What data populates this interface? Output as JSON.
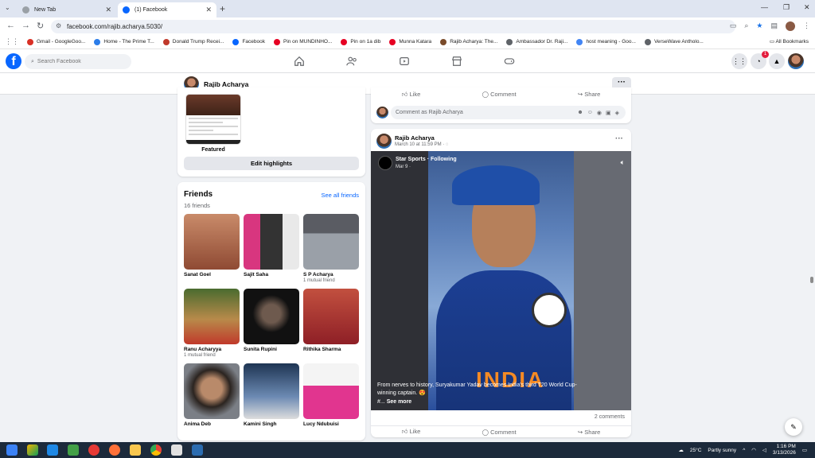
{
  "browser": {
    "tabs": [
      {
        "label": "New Tab",
        "active": false
      },
      {
        "label": "(1) Facebook",
        "active": true
      }
    ],
    "url": "facebook.com/rajib.acharya.5030/",
    "bookmarks": [
      {
        "label": "Gmail - GoogleGoo...",
        "color": "#d93025"
      },
      {
        "label": "Home - The Prime T...",
        "color": "#2b7de9"
      },
      {
        "label": "Donald Trump Recei...",
        "color": "#c0392b"
      },
      {
        "label": "Facebook",
        "color": "#0866ff"
      },
      {
        "label": "Pin on MUNDINHO...",
        "color": "#e60023"
      },
      {
        "label": "Pin on 1a dib",
        "color": "#e60023"
      },
      {
        "label": "Munna Katara",
        "color": "#e60023"
      },
      {
        "label": "Rajib Acharya: The...",
        "color": "#7a4b2a"
      },
      {
        "label": "Ambassador Dr. Raji...",
        "color": "#5f6368"
      },
      {
        "label": "host meaning - Goo...",
        "color": "#4285f4"
      },
      {
        "label": "VerseWave Antholo...",
        "color": "#5f6368"
      }
    ],
    "all_bookmarks": "All Bookmarks"
  },
  "fb": {
    "search_placeholder": "Search Facebook",
    "notif_count": "1"
  },
  "profile": {
    "name": "Rajib Acharya"
  },
  "highlights": {
    "featured_label": "Featured",
    "edit_button": "Edit highlights"
  },
  "friends": {
    "title": "Friends",
    "count": "16 friends",
    "see_all": "See all friends",
    "list": [
      {
        "name": "Sanat Goel",
        "mutual": "",
        "color": "#a9593f"
      },
      {
        "name": "Sajit Saha",
        "mutual": "",
        "color": "#c9367a"
      },
      {
        "name": "S P Acharya",
        "mutual": "1 mutual friend",
        "color": "#7d8088"
      },
      {
        "name": "Ranu Acharyya",
        "mutual": "1 mutual friend",
        "color": "#8a6a3c"
      },
      {
        "name": "Sunita Rupini",
        "mutual": "",
        "color": "#1a1a1a"
      },
      {
        "name": "Rithika Sharma",
        "mutual": "",
        "color": "#a93226"
      },
      {
        "name": "Anima Deb",
        "mutual": "",
        "color": "#5d4a3d"
      },
      {
        "name": "Kamini Singh",
        "mutual": "",
        "color": "#2c4a6e"
      },
      {
        "name": "Lucy Ndubuisi",
        "mutual": "",
        "color": "#d63384"
      }
    ]
  },
  "prev_post": {
    "actions": [
      "Like",
      "Comment",
      "Share"
    ],
    "comment_placeholder": "Comment as Rajib Acharya"
  },
  "post": {
    "author": "Rajib Acharya",
    "time": "March 10 at 11:59 PM ·",
    "channel": "Star Sports",
    "following": "· Following",
    "channel_date": "Mar 9 ·",
    "caption": "From nerves to history, Suryakumar Yadav becomes India's third T20 World Cup-winning captain.",
    "caption_emoji": "😍",
    "hashtag": "#...",
    "see_more": "See more",
    "comments": "2 comments",
    "actions": [
      "Like",
      "Comment",
      "Share"
    ]
  },
  "taskbar": {
    "weather": "25°C",
    "weather_desc": "Partly sunny",
    "time": "1:16 PM",
    "date": "3/13/2026"
  }
}
